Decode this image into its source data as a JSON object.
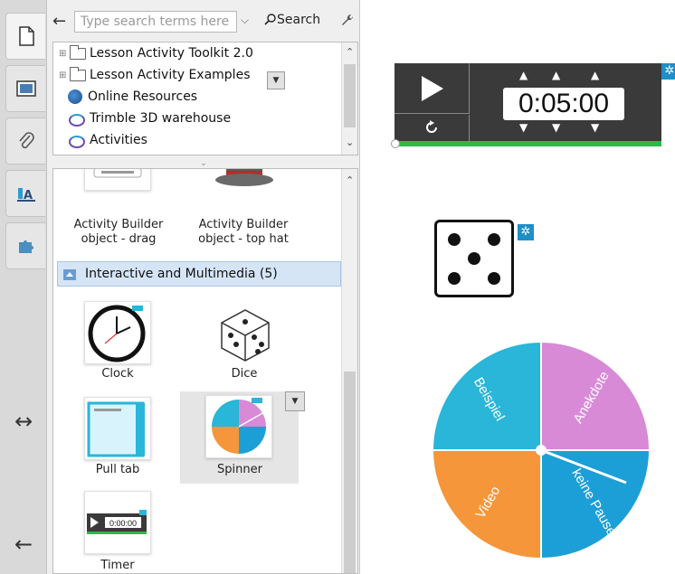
{
  "search": {
    "placeholder": "Type search terms here",
    "button_label": "Search"
  },
  "tree": {
    "items": [
      {
        "label": "Lesson Activity Toolkit 2.0",
        "icon": "folder-icon"
      },
      {
        "label": "Lesson Activity Examples",
        "icon": "folder-icon"
      },
      {
        "label": "Online Resources",
        "icon": "globe-icon"
      },
      {
        "label": "Trimble 3D warehouse",
        "icon": "swirl-icon"
      },
      {
        "label": "Activities",
        "icon": "swirl-icon"
      }
    ]
  },
  "gallery": {
    "top_items": [
      {
        "label_line1": "Activity Builder",
        "label_line2": "object - drag"
      },
      {
        "label_line1": "Activity Builder",
        "label_line2": "object - top hat"
      }
    ],
    "category": "Interactive and Multimedia (5)",
    "items": [
      {
        "label": "Clock"
      },
      {
        "label": "Dice"
      },
      {
        "label": "Pull tab"
      },
      {
        "label": "Spinner"
      },
      {
        "label": "Timer"
      }
    ]
  },
  "timer": {
    "display": "0:05:00",
    "progress": 1.0
  },
  "dice": {
    "face_value": 5
  },
  "spinner": {
    "segments": [
      {
        "label": "Beispiel",
        "color": "#29b6d8"
      },
      {
        "label": "Anekdote",
        "color": "#d88ad6"
      },
      {
        "label": "keine Pause",
        "color": "#1c9fd6"
      },
      {
        "label": "Video",
        "color": "#f5963a"
      }
    ]
  },
  "colors": {
    "accent_blue": "#1e8fc9",
    "timer_green": "#2fb84a",
    "category_bg": "#d6e5f6"
  }
}
